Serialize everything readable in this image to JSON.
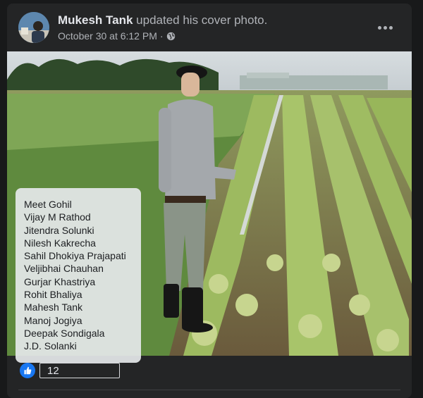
{
  "post": {
    "author": "Mukesh Tank",
    "action": " updated his cover photo.",
    "timestamp": "October 30 at 6:12 PM",
    "separator": "·",
    "privacy_icon": "globe-icon",
    "more_icon": "more-horizontal-icon"
  },
  "overlay": {
    "names": [
      "Meet Gohil",
      "Vijay M Rathod",
      "Jitendra Solunki",
      "Nilesh Kakrecha",
      "Sahil Dhokiya Prajapati",
      "Veljibhai Chauhan",
      "Gurjar Khastriya",
      "Rohit Bhaliya",
      "Mahesh Tank",
      "Manoj Jogiya",
      "Deepak Sondigala",
      "J.D. Solanki"
    ]
  },
  "reactions": {
    "icon": "like-icon",
    "count": "12"
  },
  "colors": {
    "background": "#18191a",
    "card": "#242526",
    "like": "#1877f2"
  }
}
